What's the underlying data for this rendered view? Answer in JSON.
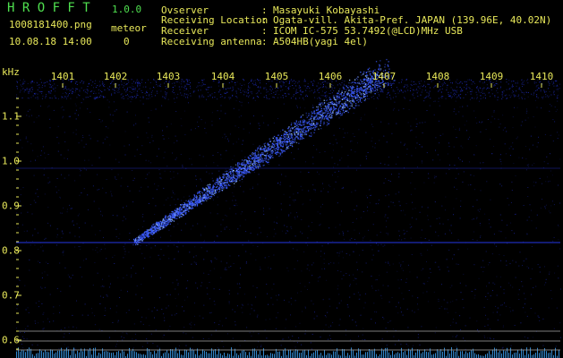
{
  "app": {
    "name": "H R O F F T",
    "version": "1.0.0",
    "filename": "1008181400.png",
    "datetime": "10.08.18 14:00",
    "meteor_label": "meteor",
    "meteor_count": "0"
  },
  "info": {
    "labels": [
      "Ovserver",
      "Receiving Location",
      "Receiver",
      "Receiving antenna"
    ],
    "sep": ":",
    "values": [
      "Masayuki Kobayashi",
      "Ogata-vill. Akita-Pref. JAPAN (139.96E, 40.02N)",
      "ICOM IC-575 53.7492(@LCD)MHz USB",
      "A504HB(yagi 4el)"
    ]
  },
  "plot": {
    "x_labels": [
      "1401",
      "1402",
      "1403",
      "1404",
      "1405",
      "1406",
      "1407",
      "1408",
      "1409",
      "1410"
    ],
    "y_unit": "kHz",
    "y_labels": [
      "1.1",
      "1.0",
      "0.9",
      "0.8",
      "0.7",
      "0.6"
    ]
  },
  "colors": {
    "label_yellow": "#e8e85a",
    "title_green": "#4fe04f",
    "signal_blue": "#2a3cff",
    "background": "#000000"
  }
}
